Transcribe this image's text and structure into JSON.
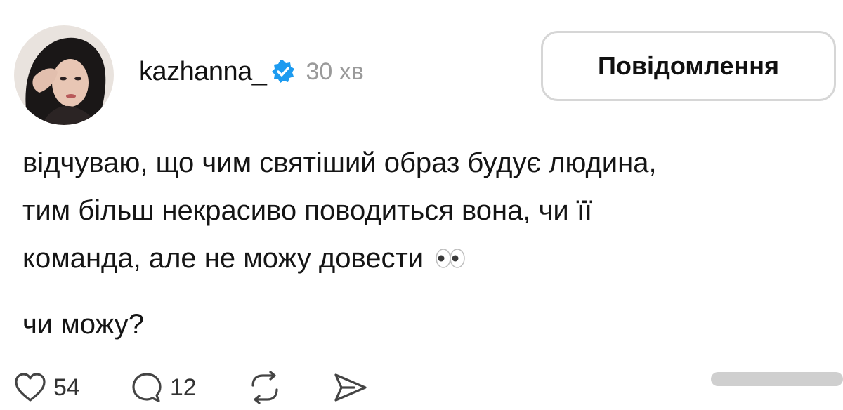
{
  "post": {
    "username": "kazhanna_",
    "timestamp": "30 хв",
    "verified": true,
    "text_lines": [
      "відчуваю, що чим святіший образ будує людина,",
      "тим більш некрасиво поводиться вона, чи її",
      "команда, але не можу довести"
    ],
    "emoji": "eyes-emoji",
    "question": "чи можу?"
  },
  "header": {
    "message_button_label": "Повідомлення"
  },
  "actions": {
    "likes_count": "54",
    "comments_count": "12",
    "icons": [
      "heart-icon",
      "comment-icon",
      "repost-icon",
      "share-icon"
    ]
  },
  "colors": {
    "verified_badge": "#1d9bf0",
    "timestamp": "#9a9a9a",
    "button_border": "#d6d6d6"
  }
}
